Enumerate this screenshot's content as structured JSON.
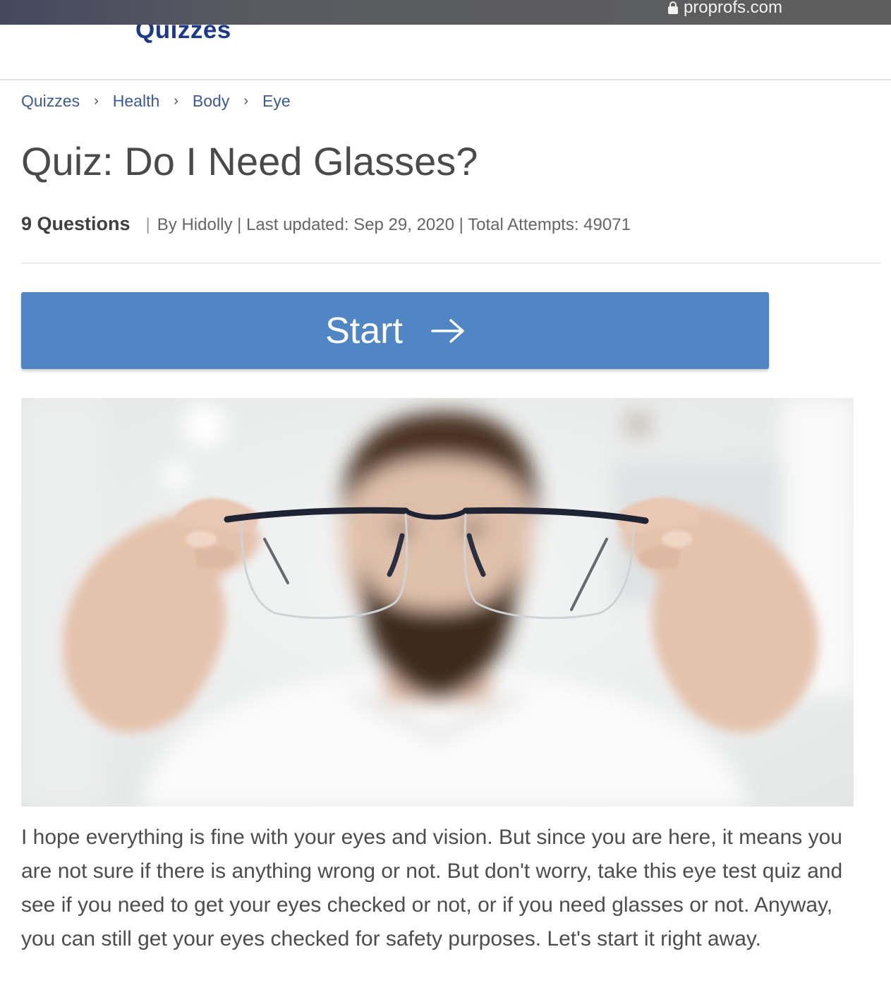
{
  "browser": {
    "url": "proprofs.com"
  },
  "site": {
    "logo_text": "Quizzes"
  },
  "breadcrumb": {
    "items": [
      "Quizzes",
      "Health",
      "Body",
      "Eye"
    ],
    "separator": "›"
  },
  "quiz": {
    "title": "Quiz: Do I Need Glasses?",
    "questions": "9 Questions",
    "separator": "|",
    "byline": "By Hidolly | Last updated: Sep 29, 2020 | Total Attempts: 49071",
    "start_label": "Start",
    "description": "I hope everything is fine with your eyes and vision. But since you are here, it means you are not sure if there is anything wrong or not. But don't worry, take this eye test quiz and see if you need to get your eyes checked or not, or if you need glasses or not. Anyway, you can still get your eyes checked for safety purposes. Let's start it right away."
  },
  "colors": {
    "start_button": "#5186c4",
    "breadcrumb_link": "#3b5a96",
    "logo": "#1d3a8a"
  },
  "icons": {
    "lock": "lock-icon",
    "start_arrow": "arrow-right-icon"
  }
}
